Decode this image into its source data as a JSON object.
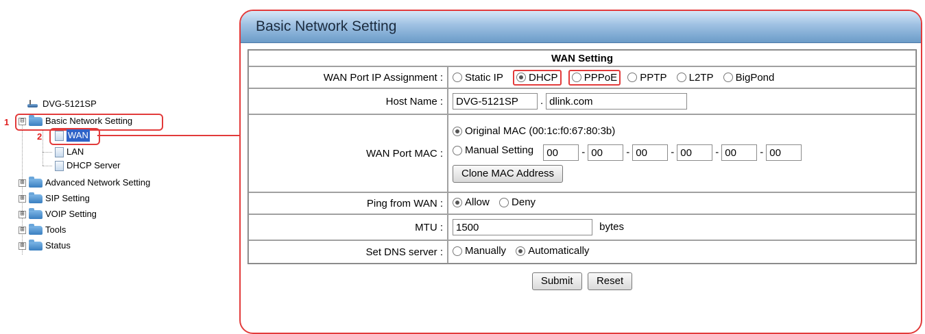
{
  "tree": {
    "root": "DVG-5121SP",
    "items": [
      {
        "label": "Basic Network Setting",
        "expander": "⊟"
      },
      {
        "label": "WAN"
      },
      {
        "label": "LAN"
      },
      {
        "label": "DHCP Server"
      },
      {
        "label": "Advanced Network Setting",
        "expander": "⊞"
      },
      {
        "label": "SIP Setting",
        "expander": "⊞"
      },
      {
        "label": "VOIP Setting",
        "expander": "⊞"
      },
      {
        "label": "Tools",
        "expander": "⊞"
      },
      {
        "label": "Status",
        "expander": "⊞"
      }
    ],
    "step_labels": [
      "1",
      "2"
    ]
  },
  "panel": {
    "title": "Basic Network Setting",
    "section_title": "WAN Setting",
    "rows": {
      "ip_assignment": {
        "label": "WAN Port IP Assignment :",
        "options": [
          "Static IP",
          "DHCP",
          "PPPoE",
          "PPTP",
          "L2TP",
          "BigPond"
        ],
        "selected": "DHCP"
      },
      "host_name": {
        "label": "Host Name :",
        "host_value": "DVG-5121SP",
        "separator": ".",
        "domain_value": "dlink.com"
      },
      "mac": {
        "label": "WAN Port MAC :",
        "original_option": "Original MAC (00:1c:f0:67:80:3b)",
        "manual_option": "Manual Setting",
        "mac_fields": [
          "00",
          "00",
          "00",
          "00",
          "00",
          "00"
        ],
        "separator": "-",
        "clone_button": "Clone MAC Address",
        "selected": "original"
      },
      "ping": {
        "label": "Ping from WAN :",
        "options": [
          "Allow",
          "Deny"
        ],
        "selected": "Allow"
      },
      "mtu": {
        "label": "MTU :",
        "value": "1500",
        "unit": "bytes"
      },
      "dns": {
        "label": "Set DNS server :",
        "options": [
          "Manually",
          "Automatically"
        ],
        "selected": "Automatically"
      }
    },
    "buttons": {
      "submit": "Submit",
      "reset": "Reset"
    }
  },
  "colors": {
    "highlight": "#e23a3a",
    "header_gradient_top": "#d6e7f6",
    "header_gradient_bottom": "#6c9cc8",
    "selection": "#2f63c8"
  }
}
